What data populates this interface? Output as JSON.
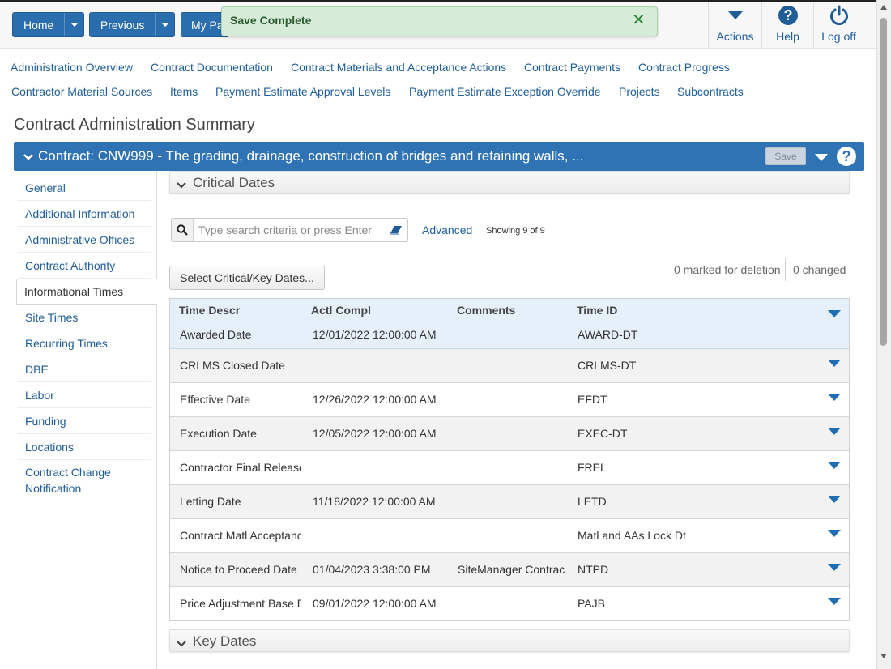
{
  "topbar": {
    "home_label": "Home",
    "previous_label": "Previous",
    "mypages_label": "My Pa",
    "actions_label": "Actions",
    "help_label": "Help",
    "logoff_label": "Log off"
  },
  "toast": {
    "message": "Save Complete",
    "close_symbol": "✕"
  },
  "nav_links": [
    "Administration Overview",
    "Contract Documentation",
    "Contract Materials and Acceptance Actions",
    "Contract Payments",
    "Contract Progress",
    "Contractor Material Sources",
    "Items",
    "Payment Estimate Approval Levels",
    "Payment Estimate Exception Override",
    "Projects",
    "Subcontracts"
  ],
  "page_title": "Contract Administration Summary",
  "contract_bar": {
    "title": "Contract: CNW999 - The grading, drainage, construction of bridges and retaining walls, ...",
    "save_label": "Save",
    "help_symbol": "?"
  },
  "sidebar": {
    "items": [
      "General",
      "Additional Information",
      "Administrative Offices",
      "Contract Authority",
      "Informational Times",
      "Site Times",
      "Recurring Times",
      "DBE",
      "Labor",
      "Funding",
      "Locations",
      "Contract Change Notification"
    ],
    "active": "Informational Times"
  },
  "critical_section": {
    "title": "Critical Dates"
  },
  "key_section": {
    "title": "Key Dates"
  },
  "search": {
    "placeholder": "Type search criteria or press Enter",
    "value": ""
  },
  "advanced_label": "Advanced",
  "showing_text": "Showing 9 of 9",
  "select_button_label": "Select Critical/Key Dates...",
  "marked_text": "0 marked for deletion",
  "changed_text": "0 changed",
  "table": {
    "columns": [
      "Time Descr",
      "Actl Compl",
      "Comments",
      "Time ID"
    ],
    "rows": [
      {
        "descr": "Awarded Date",
        "actl": "12/01/2022 12:00:00 AM",
        "comments": "",
        "time_id": "AWARD-DT"
      },
      {
        "descr": "CRLMS Closed Date",
        "actl": "",
        "comments": "",
        "time_id": "CRLMS-DT"
      },
      {
        "descr": "Effective Date",
        "actl": "12/26/2022 12:00:00 AM",
        "comments": "",
        "time_id": "EFDT"
      },
      {
        "descr": "Execution Date",
        "actl": "12/05/2022 12:00:00 AM",
        "comments": "",
        "time_id": "EXEC-DT"
      },
      {
        "descr": "Contractor Final Release",
        "actl": "",
        "comments": "",
        "time_id": "FREL"
      },
      {
        "descr": "Letting Date",
        "actl": "11/18/2022 12:00:00 AM",
        "comments": "",
        "time_id": "LETD"
      },
      {
        "descr": "Contract Matl Acceptance",
        "actl": "",
        "comments": "",
        "time_id": "Matl and AAs Lock Dt"
      },
      {
        "descr": "Notice to Proceed Date",
        "actl": "01/04/2023 3:38:00 PM",
        "comments": "SiteManager Contract",
        "time_id": "NTPD"
      },
      {
        "descr": "Price Adjustment Base Date",
        "actl": "09/01/2022 12:00:00 AM",
        "comments": "",
        "time_id": "PAJB"
      }
    ]
  },
  "colors": {
    "brand_blue": "#2f73b4",
    "link_blue": "#1f5d98",
    "toast_green": "#d6ecd9"
  }
}
